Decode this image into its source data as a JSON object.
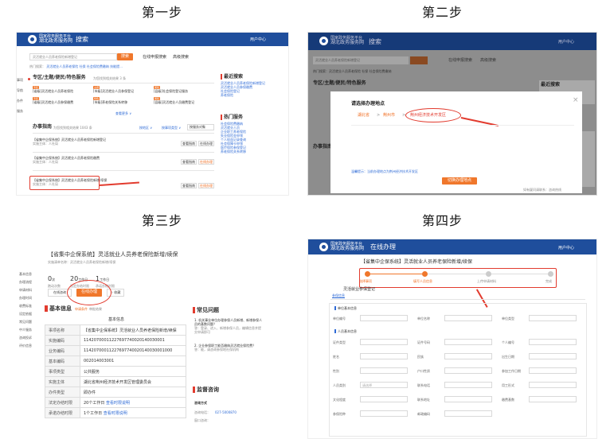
{
  "steps": [
    "第一步",
    "第二步",
    "第三步",
    "第四步"
  ],
  "colors": {
    "header": "#1f4e9c",
    "accent": "#f0772b",
    "highlight": "#e23b2e",
    "link": "#2f6bd6"
  },
  "portal": {
    "logo_line1": "国家政务服务平台",
    "logo_line2": "湖北政务服务网",
    "section_search": "搜索",
    "section_online": "在线办理",
    "user": "用户中心"
  },
  "step1": {
    "search_placeholder": "灵活就业人员养老保险新增登记",
    "search_button": "搜索",
    "search_online": "在线申报搜索",
    "search_advanced": "高级搜索",
    "hot_label": "热门搜索：",
    "hot_items": [
      "灵活就业人员养老保险",
      "社保",
      "社会保险费缴纳",
      "技能提..."
    ],
    "side_nav": [
      "事项",
      "导航",
      "办件",
      "服务"
    ],
    "theme_title": "专区/主题/便民/特色服务",
    "theme_count": "为您找到相关结果 3 条",
    "theme_items": [
      {
        "tag": "专区",
        "text": "[省级]灵活就业人员养老保险"
      },
      {
        "tag": "主题",
        "text": "[市级]灵活就业人员参保登记"
      },
      {
        "tag": "便民",
        "text": "[县级]社会保险登记服务"
      },
      {
        "tag": "专区",
        "text": "[省级]灵活就业人员参保缴费"
      },
      {
        "tag": "特色",
        "text": "[市级]养老保险关系转移"
      },
      {
        "tag": "便民",
        "text": "[县级]灵活就业人员缴费登记"
      }
    ],
    "expand_more": "查看更多 ∨",
    "matter_title": "办事指南",
    "matter_count": "为您找到相关结果 1043 条",
    "matter_filter1": "按地区 ∨",
    "matter_filter2": "按事项类型 ∨",
    "matter_filter3": "按服务对象",
    "results": [
      {
        "title": "【省集中企保系统】灵活就业人员养老保险新增登记",
        "sub": "实施主体：人社局",
        "b1": "查看指南",
        "b2": "在线办理"
      },
      {
        "title": "【省集中企保系统】灵活就业人员养老保险缴费",
        "sub": "实施主体：人社局",
        "b1": "查看指南",
        "b2": "在线办理"
      },
      {
        "title": "【省集中企保系统】灵活就业人员养老保险新增/续保",
        "sub": "实施主体：人社局",
        "b1": "查看指南",
        "b2": "在线办理"
      }
    ],
    "recent_title": "最近搜索",
    "recent_items": [
      "灵活就业人员养老保险新增登记",
      "灵活就业人员参保缴费",
      "社会保险登记",
      "养老保险"
    ],
    "hot_title": "热门服务",
    "hot_service_items": [
      "社会保险费缴纳",
      "灵活就业人员",
      "企业职工养老保险",
      "失业保险金申领",
      "个人权益记录查询",
      "社会保障卡申领",
      "医疗保险参保登记",
      "养老保险关系转移"
    ]
  },
  "step2": {
    "modal_title": "请选择办理地点",
    "loc_province": "湖北省",
    "loc_city": "荆州市",
    "loc_district": "荆州经济技术开发区",
    "note": "温馨提示：当前办理地点为荆州经济技术开发区",
    "confirm": "切换办理地点",
    "footer_link": "如有疑问请联系：咨询热线",
    "close": "×"
  },
  "step3": {
    "title": "【省集中企保系统】灵活就业人员养老保险新增/续保",
    "code": "实施清单名称：灵活就业人员养老保险新增/续保",
    "stats": [
      {
        "n": "0",
        "u": "次",
        "label": "跑动次数"
      },
      {
        "n": "20",
        "u": "工作日",
        "label": "法定办结时限"
      },
      {
        "n": "1",
        "u": "工作日",
        "label": "承诺办结时限"
      }
    ],
    "btn_consult": "在线咨询",
    "btn_handle": "在线办理",
    "btn_fav": "☆ 收藏",
    "side_nav": [
      "基本信息",
      "办理流程",
      "申请材料",
      "办理时间",
      "收费标准",
      "设定依据",
      "常见问题",
      "中介服务",
      "咨询投诉",
      "评价信息"
    ],
    "info_title": "基本信息",
    "info_tab1": "申请条件",
    "info_tab2": "审批结果",
    "table_caption": "基本信息",
    "table": [
      {
        "k": "事项名称",
        "v": "【省集中企保系统】灵活就业人员养老保险新增/续保"
      },
      {
        "k": "实施编码",
        "v": "11420700011227697740020140030001"
      },
      {
        "k": "业务编码",
        "v": "11420700011227697740020140030001000"
      },
      {
        "k": "基本编码",
        "v": "002014003001"
      },
      {
        "k": "事项类型",
        "v": "公共服务"
      },
      {
        "k": "实施主体",
        "v": "湖北省荆州经济技术开发区管理委员会"
      },
      {
        "k": "办件类型",
        "v": "即办件"
      },
      {
        "k": "法定办结时限",
        "v": "20个工作日"
      },
      {
        "k": "承诺办结时限",
        "v": "1个工作日"
      }
    ],
    "table_link": "查看时限说明",
    "faq_title": "常见问题",
    "faq": [
      {
        "q": "1. 机关事业单位办理参保人员新增、新增参保人员的基数问题？",
        "a": "答：登录、进入、新增参保人员，编辑信息并提交申请即可"
      },
      {
        "q": "2. 企业参保职工能否缴纳灵活就业保险费？",
        "a": "答：能，请咨询参保地社保机构"
      }
    ],
    "supervise_title": "监督咨询",
    "consult_label": "咨询方式",
    "phone_label": "咨询电话：",
    "phone": "027-5000870",
    "window_label": "窗口咨询："
  },
  "step4": {
    "title": "【省集中企保系统】灵活就业人员养老保险新增/续保",
    "steps": [
      "选择事项",
      "填写人员信息",
      "上传申请材料",
      "完成"
    ],
    "form_title": "灵活就业参保登记",
    "tab_active": "参保信息",
    "section1": "单位基本信息",
    "section1_fields": [
      "单位编号",
      "单位名称",
      "单位类型"
    ],
    "section2": "人员基本信息",
    "section2_fields": [
      "证件类型",
      "证件号码",
      "个人编号",
      "姓名",
      "民族",
      "出生日期",
      "性别",
      "户口性质",
      "参加工作日期",
      "人员类别",
      "联系电话",
      "用工形式",
      "文化程度",
      "联系地址",
      "缴费基数",
      "参保险种",
      "邮政编码"
    ],
    "select_placeholder": "请选择"
  }
}
